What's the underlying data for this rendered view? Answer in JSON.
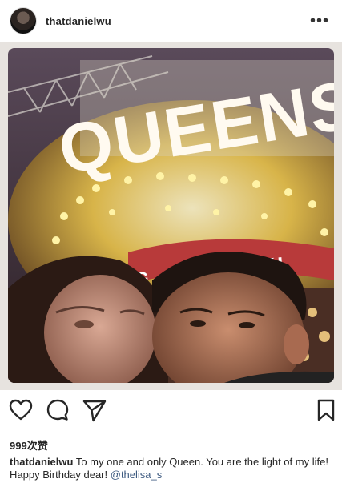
{
  "post": {
    "username": "thatdanielwu",
    "more_label": "•••",
    "likes": "999次赞",
    "caption": {
      "username": "thatdanielwu",
      "text": "To my one and only Queen. You are the light of my life! Happy Birthday dear!",
      "mention": "@thelisa_s"
    },
    "photo_sign": {
      "line1": "QUEENS",
      "line2": "PARKI",
      "line2_left": "G"
    }
  },
  "icons": {
    "like": "heart-icon",
    "comment": "comment-icon",
    "share": "share-icon",
    "save": "bookmark-icon",
    "more": "more-options-icon"
  },
  "colors": {
    "text": "#262626",
    "mention": "#3d5a80",
    "photo_bg": "#e7e3df"
  }
}
